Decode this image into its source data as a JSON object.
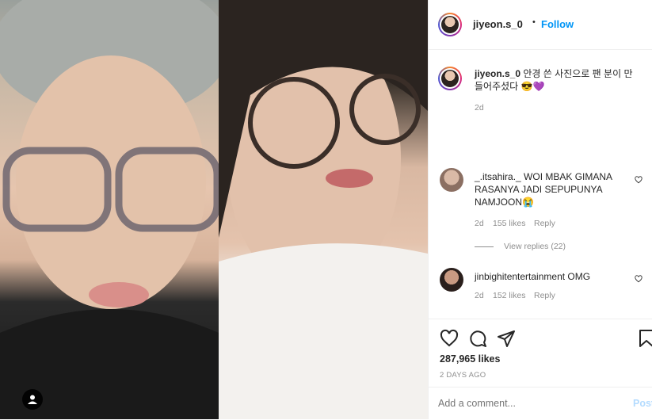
{
  "post": {
    "username": "jiyeon.s_0",
    "follow_label": "Follow",
    "separator": "•",
    "caption_text": "안경 쓴 사진으로 팬 분이 만들어주셨다 😎💜",
    "caption_age": "2d"
  },
  "comments": [
    {
      "username": "_.itsahira._",
      "text": "WOI MBAK GIMANA RASANYA JADI SEPUPUNYA NAMJOON😭",
      "age": "2d",
      "likes": "155 likes",
      "reply_label": "Reply",
      "view_replies": "View replies (22)"
    },
    {
      "username": "jinbighitentertainment",
      "text": "OMG",
      "age": "2d",
      "likes": "152 likes",
      "reply_label": "Reply"
    }
  ],
  "stats": {
    "likes": "287,965 likes",
    "date": "2 DAYS AGO"
  },
  "add_comment": {
    "placeholder": "Add a comment...",
    "post_label": "Post"
  },
  "icons": [
    "heart-icon",
    "comment-icon",
    "share-icon",
    "bookmark-icon",
    "user-tag-icon"
  ],
  "colors": {
    "link": "#0095f6",
    "muted": "#8e8e8e",
    "border": "#efefef"
  }
}
